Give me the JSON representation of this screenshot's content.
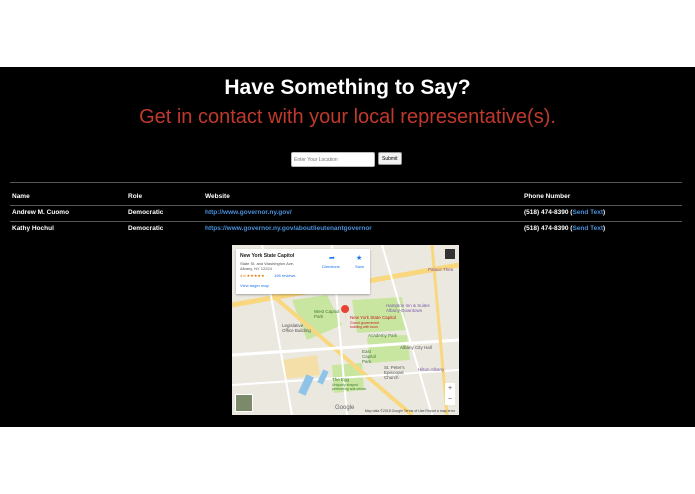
{
  "header": {
    "title": "Have Something to Say?",
    "subtitle": "Get in contact with your local representative(s)."
  },
  "search": {
    "placeholder": "Enter Your Location",
    "submit_label": "Submit"
  },
  "table": {
    "headers": [
      "Name",
      "Role",
      "Website",
      "Phone Number"
    ],
    "rows": [
      {
        "name": "Andrew M. Cuomo",
        "role": "Democratic",
        "website": "http://www.governor.ny.gov/",
        "phone": "(518) 474-8390",
        "send_text": "Send Text"
      },
      {
        "name": "Kathy Hochul",
        "role": "Democratic",
        "website": "https://www.governor.ny.gov/aboutlieutenantgovernor",
        "phone": "(518) 474-8390",
        "send_text": "Send Text"
      }
    ]
  },
  "map": {
    "place_title": "New York State Capitol",
    "address_line1": "State St. and Washington Ave,",
    "address_line2": "Albany, NY 12224",
    "rating": "4.6 ★★★★★",
    "reviews": "196 reviews",
    "view_larger": "View larger map",
    "directions_label": "Directions",
    "save_label": "Save",
    "labels": {
      "palace": "Palace Thea",
      "hampton": "Hampton Inn & Suites Albany-Downtown",
      "west_capitol": "West Capitol Park",
      "capitol_marker": "New York State Capitol",
      "capitol_desc": "Grand government building with tours",
      "legislative": "Legislative Office Building",
      "academy": "Academy Park",
      "city_hall": "Albany City Hall",
      "east_capitol": "East Capitol Park",
      "hilton": "Hilton Albany",
      "st_peters": "St. Peter's Episcopal Church",
      "egg": "The Egg",
      "egg_desc": "Uniquely shaped performing arts venue"
    },
    "footer": "Map data ©2018 Google   Terms of Use   Report a map error",
    "google_logo": "Google",
    "colors": {
      "park": "#c8e6a0",
      "road_major": "#f9d77e",
      "road_minor": "#ffffff",
      "water": "#8fc3e8",
      "marker": "#ea4335"
    }
  }
}
